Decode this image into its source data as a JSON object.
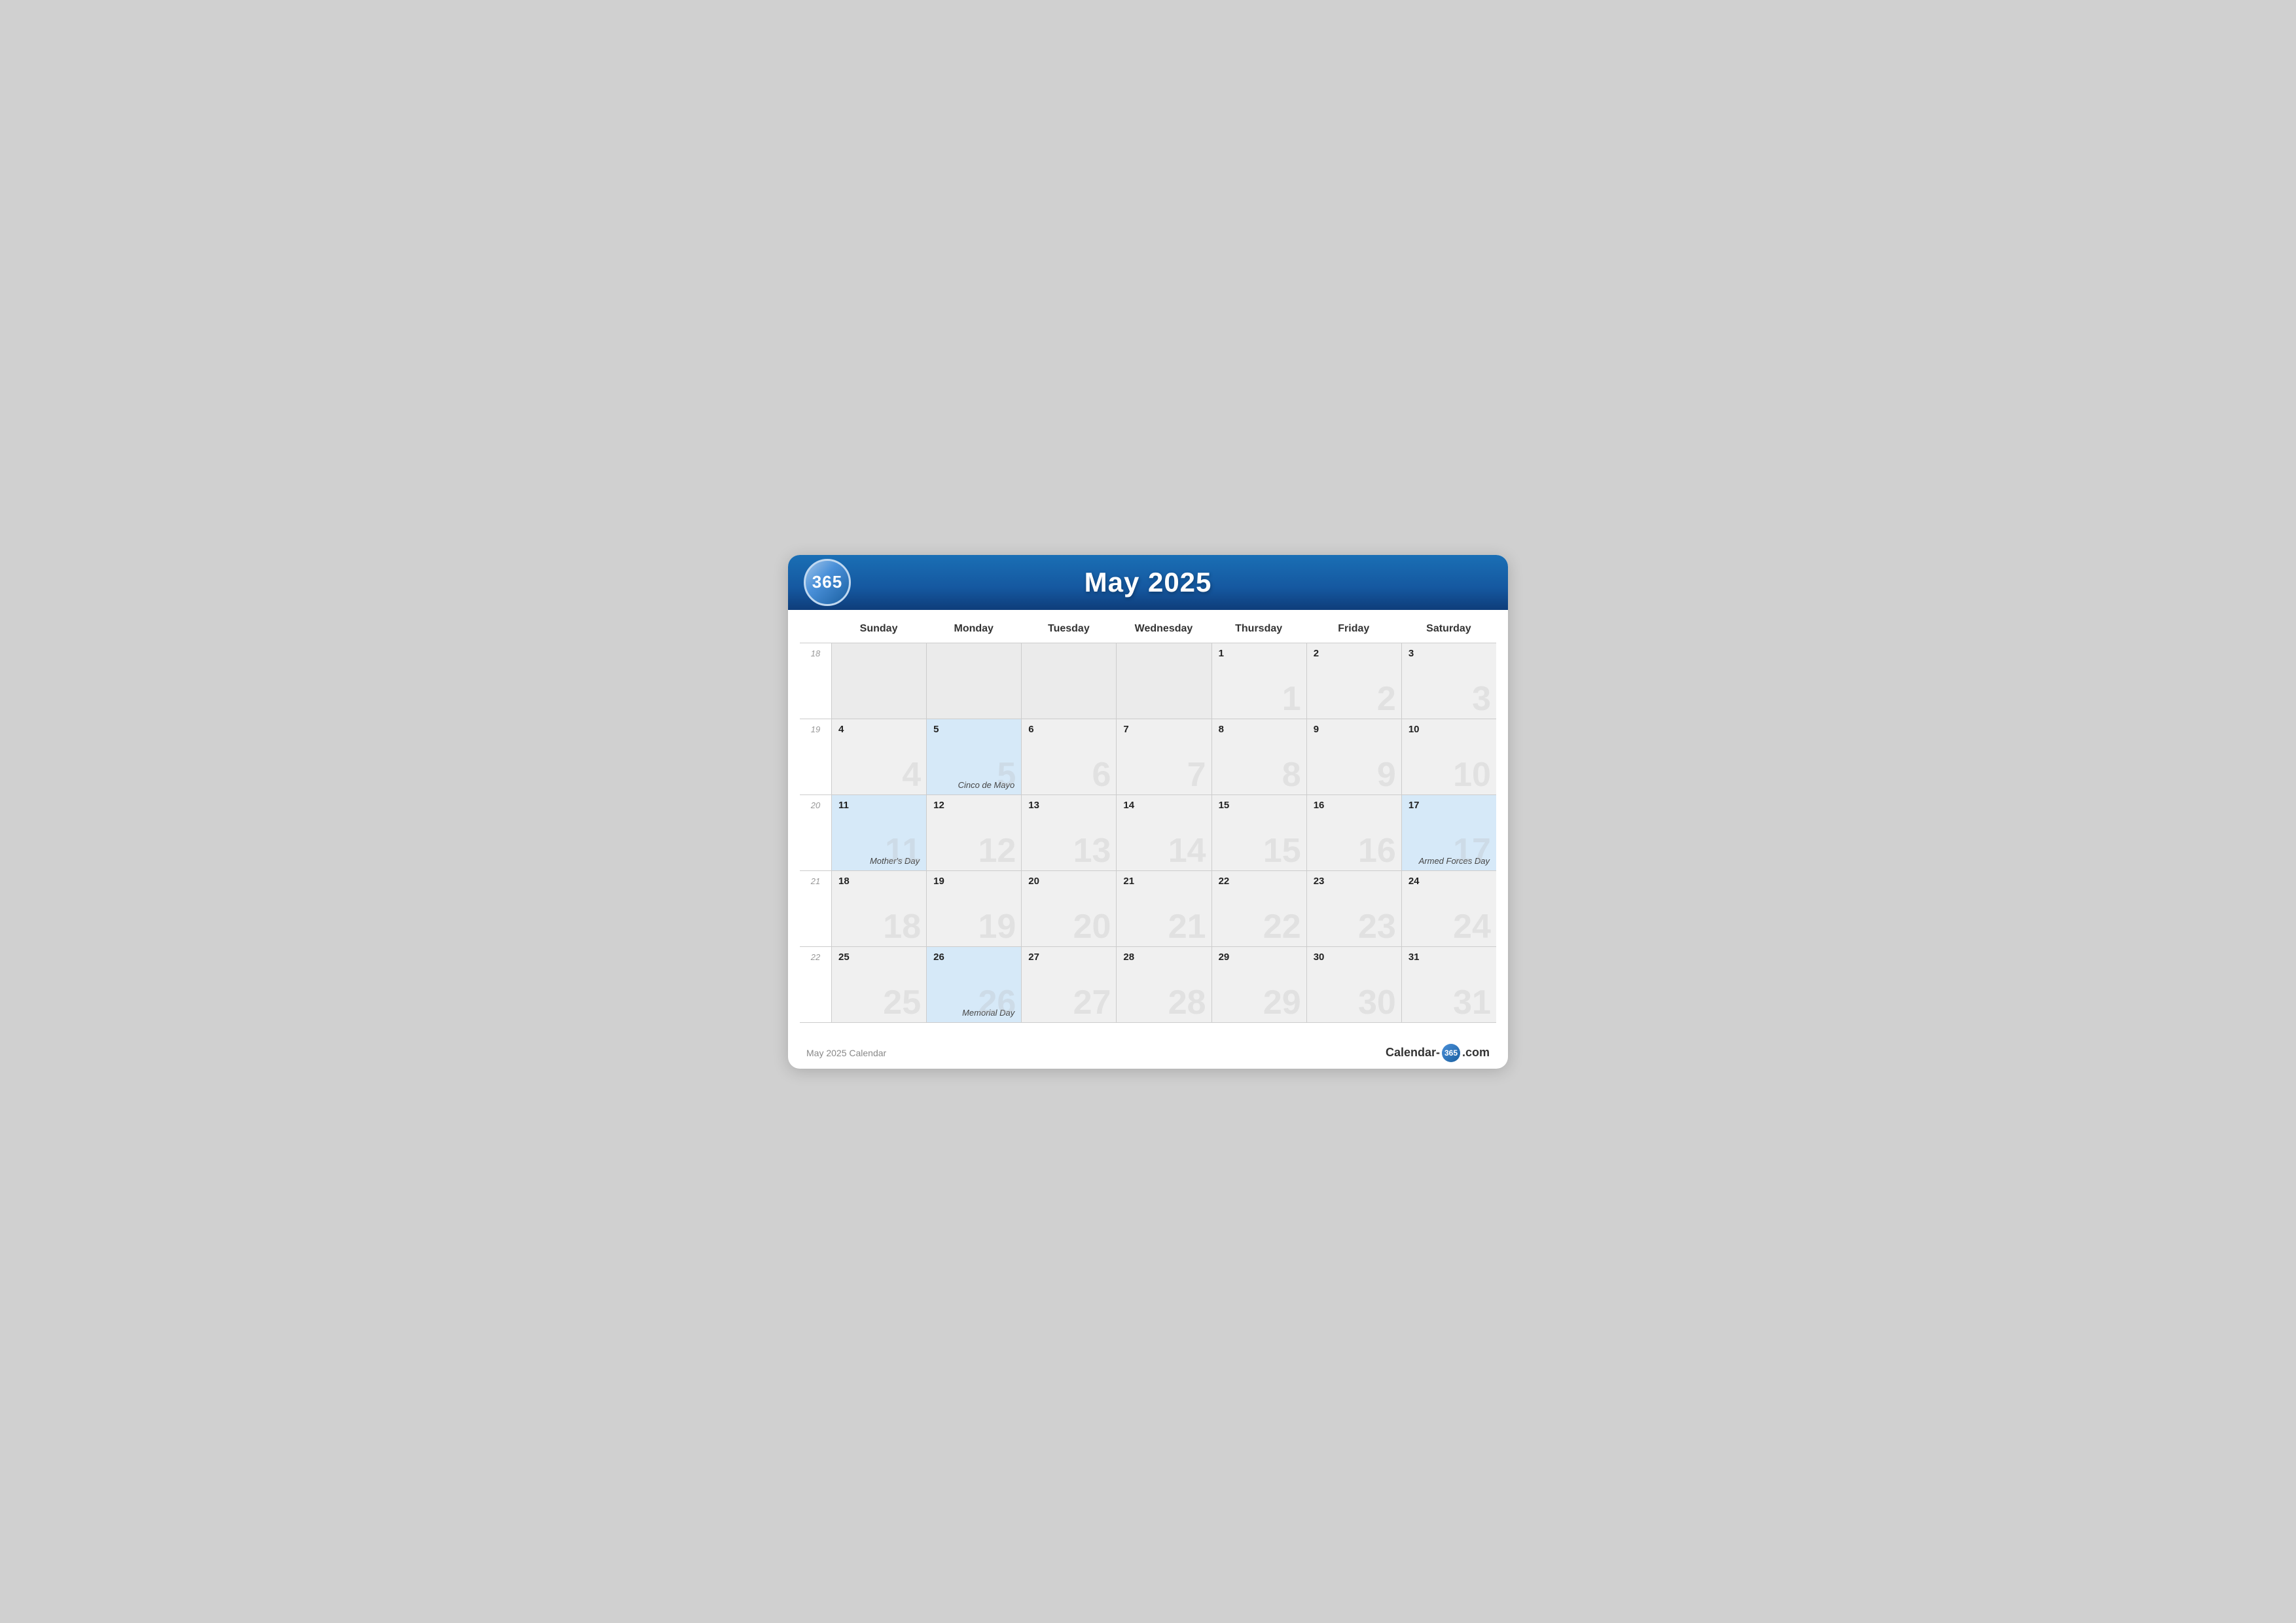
{
  "header": {
    "logo": "365",
    "title": "May 2025"
  },
  "days_of_week": [
    "Sunday",
    "Monday",
    "Tuesday",
    "Wednesday",
    "Thursday",
    "Friday",
    "Saturday"
  ],
  "weeks": [
    {
      "week_num": "18",
      "days": [
        {
          "date": "",
          "holiday": "",
          "highlight": false,
          "empty": true,
          "watermark": ""
        },
        {
          "date": "",
          "holiday": "",
          "highlight": false,
          "empty": true,
          "watermark": ""
        },
        {
          "date": "",
          "holiday": "",
          "highlight": false,
          "empty": true,
          "watermark": ""
        },
        {
          "date": "",
          "holiday": "",
          "highlight": false,
          "empty": true,
          "watermark": ""
        },
        {
          "date": "1",
          "holiday": "",
          "highlight": false,
          "empty": false,
          "watermark": "1"
        },
        {
          "date": "2",
          "holiday": "",
          "highlight": false,
          "empty": false,
          "watermark": "2"
        },
        {
          "date": "3",
          "holiday": "",
          "highlight": false,
          "empty": false,
          "watermark": "3"
        }
      ]
    },
    {
      "week_num": "19",
      "days": [
        {
          "date": "4",
          "holiday": "",
          "highlight": false,
          "empty": false,
          "watermark": "4"
        },
        {
          "date": "5",
          "holiday": "Cinco de Mayo",
          "highlight": true,
          "empty": false,
          "watermark": "5"
        },
        {
          "date": "6",
          "holiday": "",
          "highlight": false,
          "empty": false,
          "watermark": "6"
        },
        {
          "date": "7",
          "holiday": "",
          "highlight": false,
          "empty": false,
          "watermark": "7"
        },
        {
          "date": "8",
          "holiday": "",
          "highlight": false,
          "empty": false,
          "watermark": "8"
        },
        {
          "date": "9",
          "holiday": "",
          "highlight": false,
          "empty": false,
          "watermark": "9"
        },
        {
          "date": "10",
          "holiday": "",
          "highlight": false,
          "empty": false,
          "watermark": "10"
        }
      ]
    },
    {
      "week_num": "20",
      "days": [
        {
          "date": "11",
          "holiday": "Mother's Day",
          "highlight": true,
          "empty": false,
          "watermark": "11"
        },
        {
          "date": "12",
          "holiday": "",
          "highlight": false,
          "empty": false,
          "watermark": "12"
        },
        {
          "date": "13",
          "holiday": "",
          "highlight": false,
          "empty": false,
          "watermark": "13"
        },
        {
          "date": "14",
          "holiday": "",
          "highlight": false,
          "empty": false,
          "watermark": "14"
        },
        {
          "date": "15",
          "holiday": "",
          "highlight": false,
          "empty": false,
          "watermark": "15"
        },
        {
          "date": "16",
          "holiday": "",
          "highlight": false,
          "empty": false,
          "watermark": "16"
        },
        {
          "date": "17",
          "holiday": "Armed Forces Day",
          "highlight": true,
          "empty": false,
          "watermark": "17"
        }
      ]
    },
    {
      "week_num": "21",
      "days": [
        {
          "date": "18",
          "holiday": "",
          "highlight": false,
          "empty": false,
          "watermark": "18"
        },
        {
          "date": "19",
          "holiday": "",
          "highlight": false,
          "empty": false,
          "watermark": "19"
        },
        {
          "date": "20",
          "holiday": "",
          "highlight": false,
          "empty": false,
          "watermark": "20"
        },
        {
          "date": "21",
          "holiday": "",
          "highlight": false,
          "empty": false,
          "watermark": "21"
        },
        {
          "date": "22",
          "holiday": "",
          "highlight": false,
          "empty": false,
          "watermark": "22"
        },
        {
          "date": "23",
          "holiday": "",
          "highlight": false,
          "empty": false,
          "watermark": "23"
        },
        {
          "date": "24",
          "holiday": "",
          "highlight": false,
          "empty": false,
          "watermark": "24"
        }
      ]
    },
    {
      "week_num": "22",
      "days": [
        {
          "date": "25",
          "holiday": "",
          "highlight": false,
          "empty": false,
          "watermark": "25"
        },
        {
          "date": "26",
          "holiday": "Memorial Day",
          "highlight": true,
          "empty": false,
          "watermark": "26"
        },
        {
          "date": "27",
          "holiday": "",
          "highlight": false,
          "empty": false,
          "watermark": "27"
        },
        {
          "date": "28",
          "holiday": "",
          "highlight": false,
          "empty": false,
          "watermark": "28"
        },
        {
          "date": "29",
          "holiday": "",
          "highlight": false,
          "empty": false,
          "watermark": "29"
        },
        {
          "date": "30",
          "holiday": "",
          "highlight": false,
          "empty": false,
          "watermark": "30"
        },
        {
          "date": "31",
          "holiday": "",
          "highlight": false,
          "empty": false,
          "watermark": "31"
        }
      ]
    }
  ],
  "footer": {
    "left": "May 2025 Calendar",
    "logo_text_before": "Calendar-",
    "logo_num": "365",
    "logo_text_after": ".com"
  }
}
